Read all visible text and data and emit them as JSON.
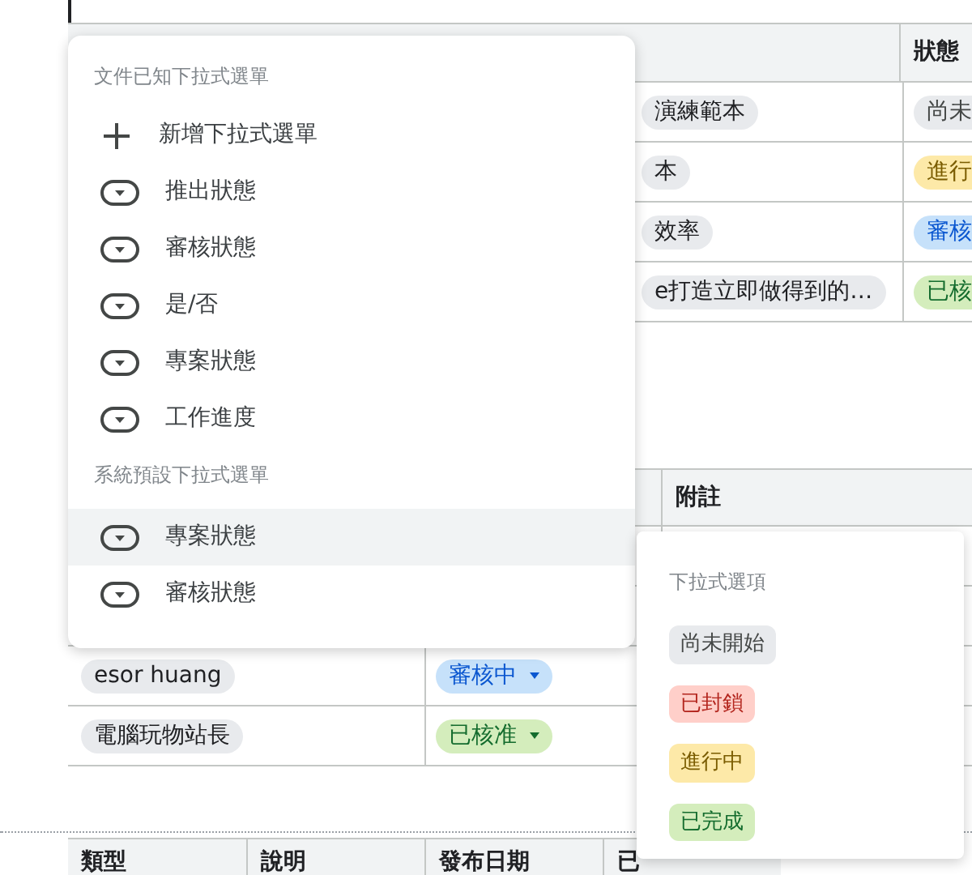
{
  "top_table": {
    "header": {
      "column_3": "狀態"
    },
    "rows": [
      {
        "chip": "演練範本",
        "status": {
          "label": "尚未",
          "color": "#e8eaed"
        }
      },
      {
        "chip": "本",
        "status": {
          "label": "進行",
          "color": "#fde9a8"
        }
      },
      {
        "chip": "效率",
        "status": {
          "label": "審核",
          "color": "#c6e1fa"
        }
      },
      {
        "chip": "e打造立即做得到的…",
        "status": {
          "label": "已核",
          "color": "#d4edbc"
        }
      }
    ]
  },
  "second_table": {
    "header": {
      "column_3": "附註"
    },
    "rows": [
      {
        "name": "esor huang",
        "status": {
          "label": "審核中",
          "color": "#c6e1fa"
        }
      },
      {
        "name": "電腦玩物站長",
        "status": {
          "label": "已核准",
          "color": "#d4edbc"
        }
      }
    ]
  },
  "third_table": {
    "columns": [
      "類型",
      "說明",
      "發布日期",
      "已"
    ]
  },
  "dropdown_menu": {
    "document_section": {
      "title": "文件已知下拉式選單",
      "items": [
        {
          "kind": "add",
          "label": "新增下拉式選單",
          "selected": false
        },
        {
          "kind": "dropdown",
          "label": "推出狀態",
          "selected": false
        },
        {
          "kind": "dropdown",
          "label": "審核狀態",
          "selected": false
        },
        {
          "kind": "dropdown",
          "label": "是/否",
          "selected": false
        },
        {
          "kind": "dropdown",
          "label": "專案狀態",
          "selected": false
        },
        {
          "kind": "dropdown",
          "label": "工作進度",
          "selected": false
        }
      ]
    },
    "system_section": {
      "title": "系統預設下拉式選單",
      "items": [
        {
          "kind": "dropdown",
          "label": "專案狀態",
          "selected": true
        },
        {
          "kind": "dropdown",
          "label": "審核狀態",
          "selected": false
        }
      ]
    }
  },
  "options_popup": {
    "title": "下拉式選項",
    "options": [
      {
        "label": "尚未開始",
        "color": "#e8eaed"
      },
      {
        "label": "已封鎖",
        "color": "#ffcfc9"
      },
      {
        "label": "進行中",
        "color": "#fde9a8"
      },
      {
        "label": "已完成",
        "color": "#d4edbc"
      }
    ]
  }
}
